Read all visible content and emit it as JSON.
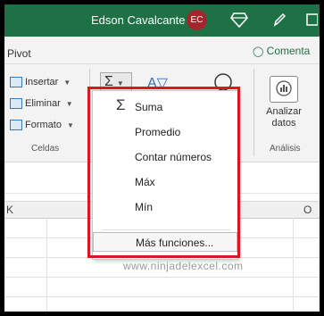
{
  "titlebar": {
    "user_name": "Edson Cavalcante",
    "avatar_initials": "EC",
    "bg_color": "#1e7145"
  },
  "ribbon": {
    "pivot_label": "Pivot",
    "comment_tab": "Comenta",
    "celdas": {
      "insertar": "Insertar",
      "eliminar": "Eliminar",
      "formato": "Formato",
      "group_label": "Celdas"
    },
    "autosum_icon": "sigma-icon",
    "analizar_datos": {
      "line1": "Analizar",
      "line2": "datos",
      "group_label": "Análisis"
    }
  },
  "sheet": {
    "column_letters": [
      "K",
      "O"
    ],
    "watermark": "www.ninjadelexcel.com"
  },
  "autosum_menu": {
    "items": [
      {
        "label": "Suma",
        "icon": "sigma-icon"
      },
      {
        "label": "Promedio"
      },
      {
        "label": "Contar números"
      },
      {
        "label": "Máx"
      },
      {
        "label": "Mín"
      },
      {
        "label": "Más funciones..."
      }
    ],
    "highlight_color": "#d7191f"
  }
}
